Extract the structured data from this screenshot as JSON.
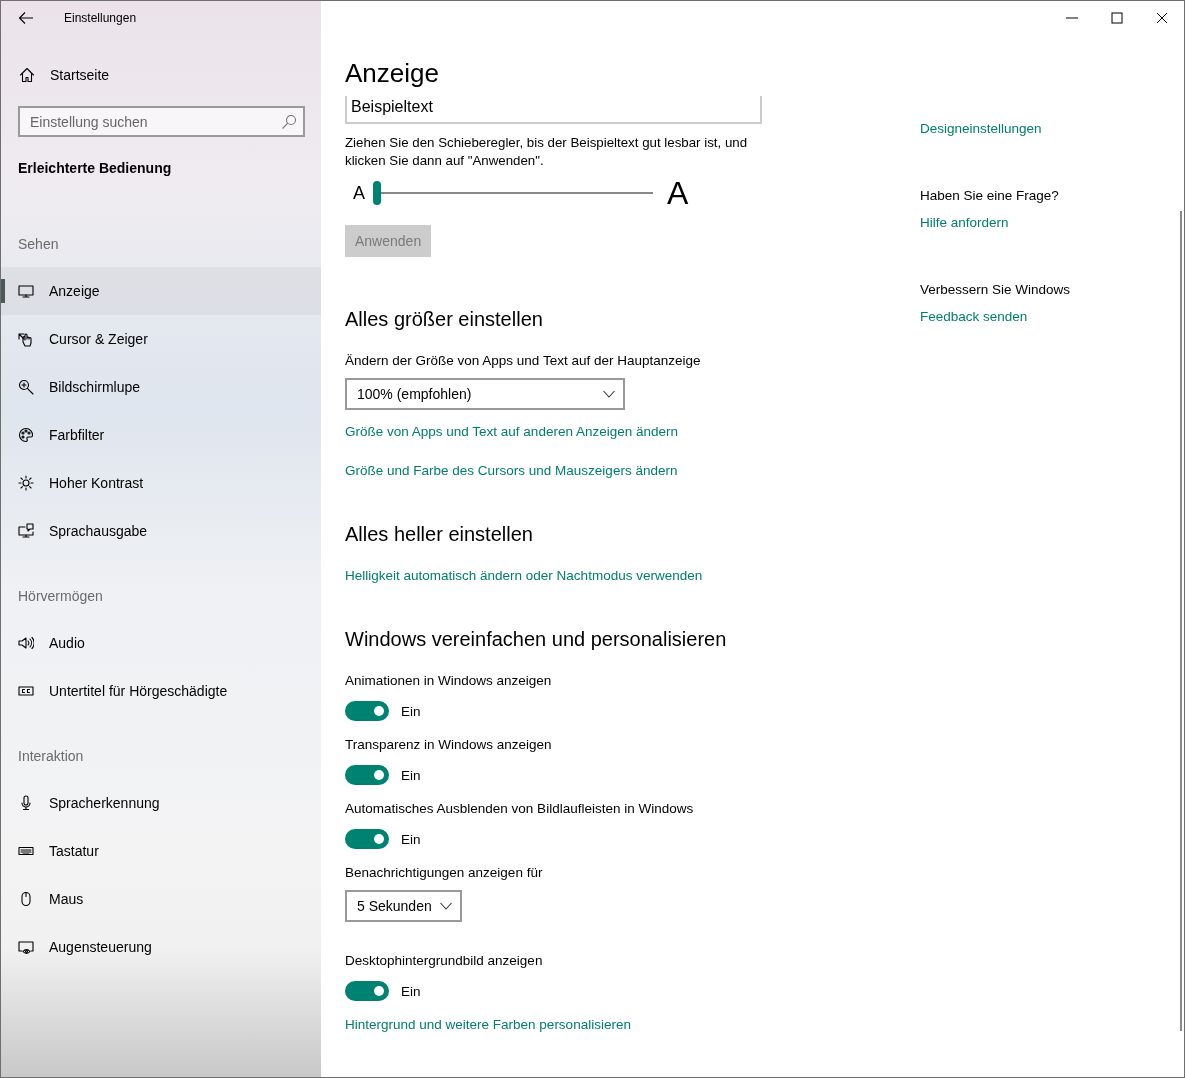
{
  "window": {
    "title": "Einstellungen"
  },
  "sidebar": {
    "home": "Startseite",
    "search": {
      "placeholder": "Einstellung suchen"
    },
    "heading": "Erleichterte Bedienung",
    "groups": [
      {
        "title": "Sehen",
        "items": [
          {
            "label": "Anzeige",
            "selected": true
          },
          {
            "label": "Cursor & Zeiger",
            "selected": false
          },
          {
            "label": "Bildschirmlupe",
            "selected": false
          },
          {
            "label": "Farbfilter",
            "selected": false
          },
          {
            "label": "Hoher Kontrast",
            "selected": false
          },
          {
            "label": "Sprachausgabe",
            "selected": false
          }
        ]
      },
      {
        "title": "Hörvermögen",
        "items": [
          {
            "label": "Audio",
            "selected": false
          },
          {
            "label": "Untertitel für Hörgeschädigte",
            "selected": false
          }
        ]
      },
      {
        "title": "Interaktion",
        "items": [
          {
            "label": "Spracherkennung",
            "selected": false
          },
          {
            "label": "Tastatur",
            "selected": false
          },
          {
            "label": "Maus",
            "selected": false
          },
          {
            "label": "Augensteuerung",
            "selected": false
          }
        ]
      }
    ]
  },
  "main": {
    "title": "Anzeige",
    "sample_text": "Beispieltext",
    "instruction": "Ziehen Sie den Schieberegler, bis der Beispieltext gut lesbar ist, und klicken Sie dann auf \"Anwenden\".",
    "text_size_slider": {
      "small_label": "A",
      "large_label": "A",
      "level": 0
    },
    "apply_button": {
      "label": "Anwenden",
      "disabled": true
    },
    "sections": [
      {
        "title": "Alles größer einstellen",
        "items": [
          {
            "kind": "label",
            "text": "Ändern der Größe von Apps und Text auf der Hauptanzeige"
          },
          {
            "kind": "dropdown",
            "value": "100% (empfohlen)",
            "wide": true
          },
          {
            "kind": "link",
            "text": "Größe von Apps und Text auf anderen Anzeigen ändern"
          },
          {
            "kind": "link",
            "text": "Größe und Farbe des Cursors und Mauszeigers ändern"
          }
        ]
      },
      {
        "title": "Alles heller einstellen",
        "items": [
          {
            "kind": "link",
            "text": "Helligkeit automatisch ändern oder Nachtmodus verwenden"
          }
        ]
      },
      {
        "title": "Windows vereinfachen und personalisieren",
        "items": [
          {
            "kind": "label",
            "text": "Animationen in Windows anzeigen"
          },
          {
            "kind": "toggle",
            "on": true,
            "state_text": "Ein"
          },
          {
            "kind": "label",
            "text": "Transparenz in Windows anzeigen"
          },
          {
            "kind": "toggle",
            "on": true,
            "state_text": "Ein"
          },
          {
            "kind": "label",
            "text": "Automatisches Ausblenden von Bildlaufleisten in Windows"
          },
          {
            "kind": "toggle",
            "on": true,
            "state_text": "Ein"
          },
          {
            "kind": "label",
            "text": "Benachrichtigungen anzeigen für"
          },
          {
            "kind": "dropdown",
            "value": "5 Sekunden",
            "wide": false
          },
          {
            "kind": "label",
            "text": "Desktophintergrundbild anzeigen"
          },
          {
            "kind": "toggle",
            "on": true,
            "state_text": "Ein"
          },
          {
            "kind": "link",
            "text": "Hintergrund und weitere Farben personalisieren"
          }
        ]
      }
    ]
  },
  "related": {
    "items": [
      {
        "kind": "link",
        "text": "Designeinstellungen"
      },
      {
        "kind": "heading",
        "text": "Haben Sie eine Frage?"
      },
      {
        "kind": "link",
        "text": "Hilfe anfordern"
      },
      {
        "kind": "heading",
        "text": "Verbessern Sie Windows"
      },
      {
        "kind": "link",
        "text": "Feedback senden"
      }
    ]
  }
}
